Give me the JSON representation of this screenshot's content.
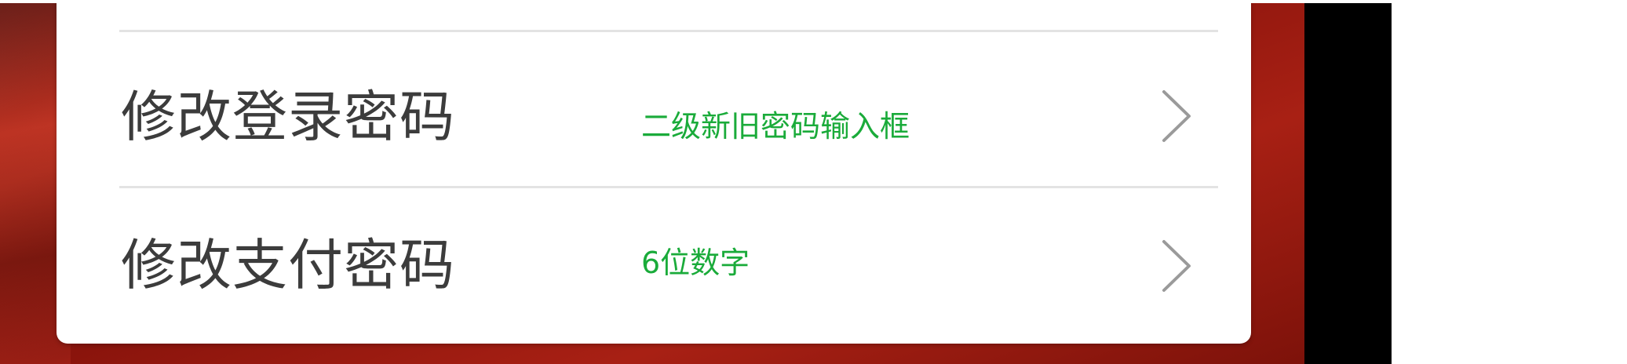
{
  "settings_list": {
    "items": [
      {
        "label": "修改登录密码",
        "hint": "二级新旧密码输入框",
        "chevron_icon": "chevron-right-icon"
      },
      {
        "label": "修改支付密码",
        "hint": "6位数字",
        "chevron_icon": "chevron-right-icon"
      }
    ]
  },
  "colors": {
    "hint_text": "#1aab3a",
    "label_text": "#3c3c3c",
    "background_accent": "#9c1a10"
  }
}
